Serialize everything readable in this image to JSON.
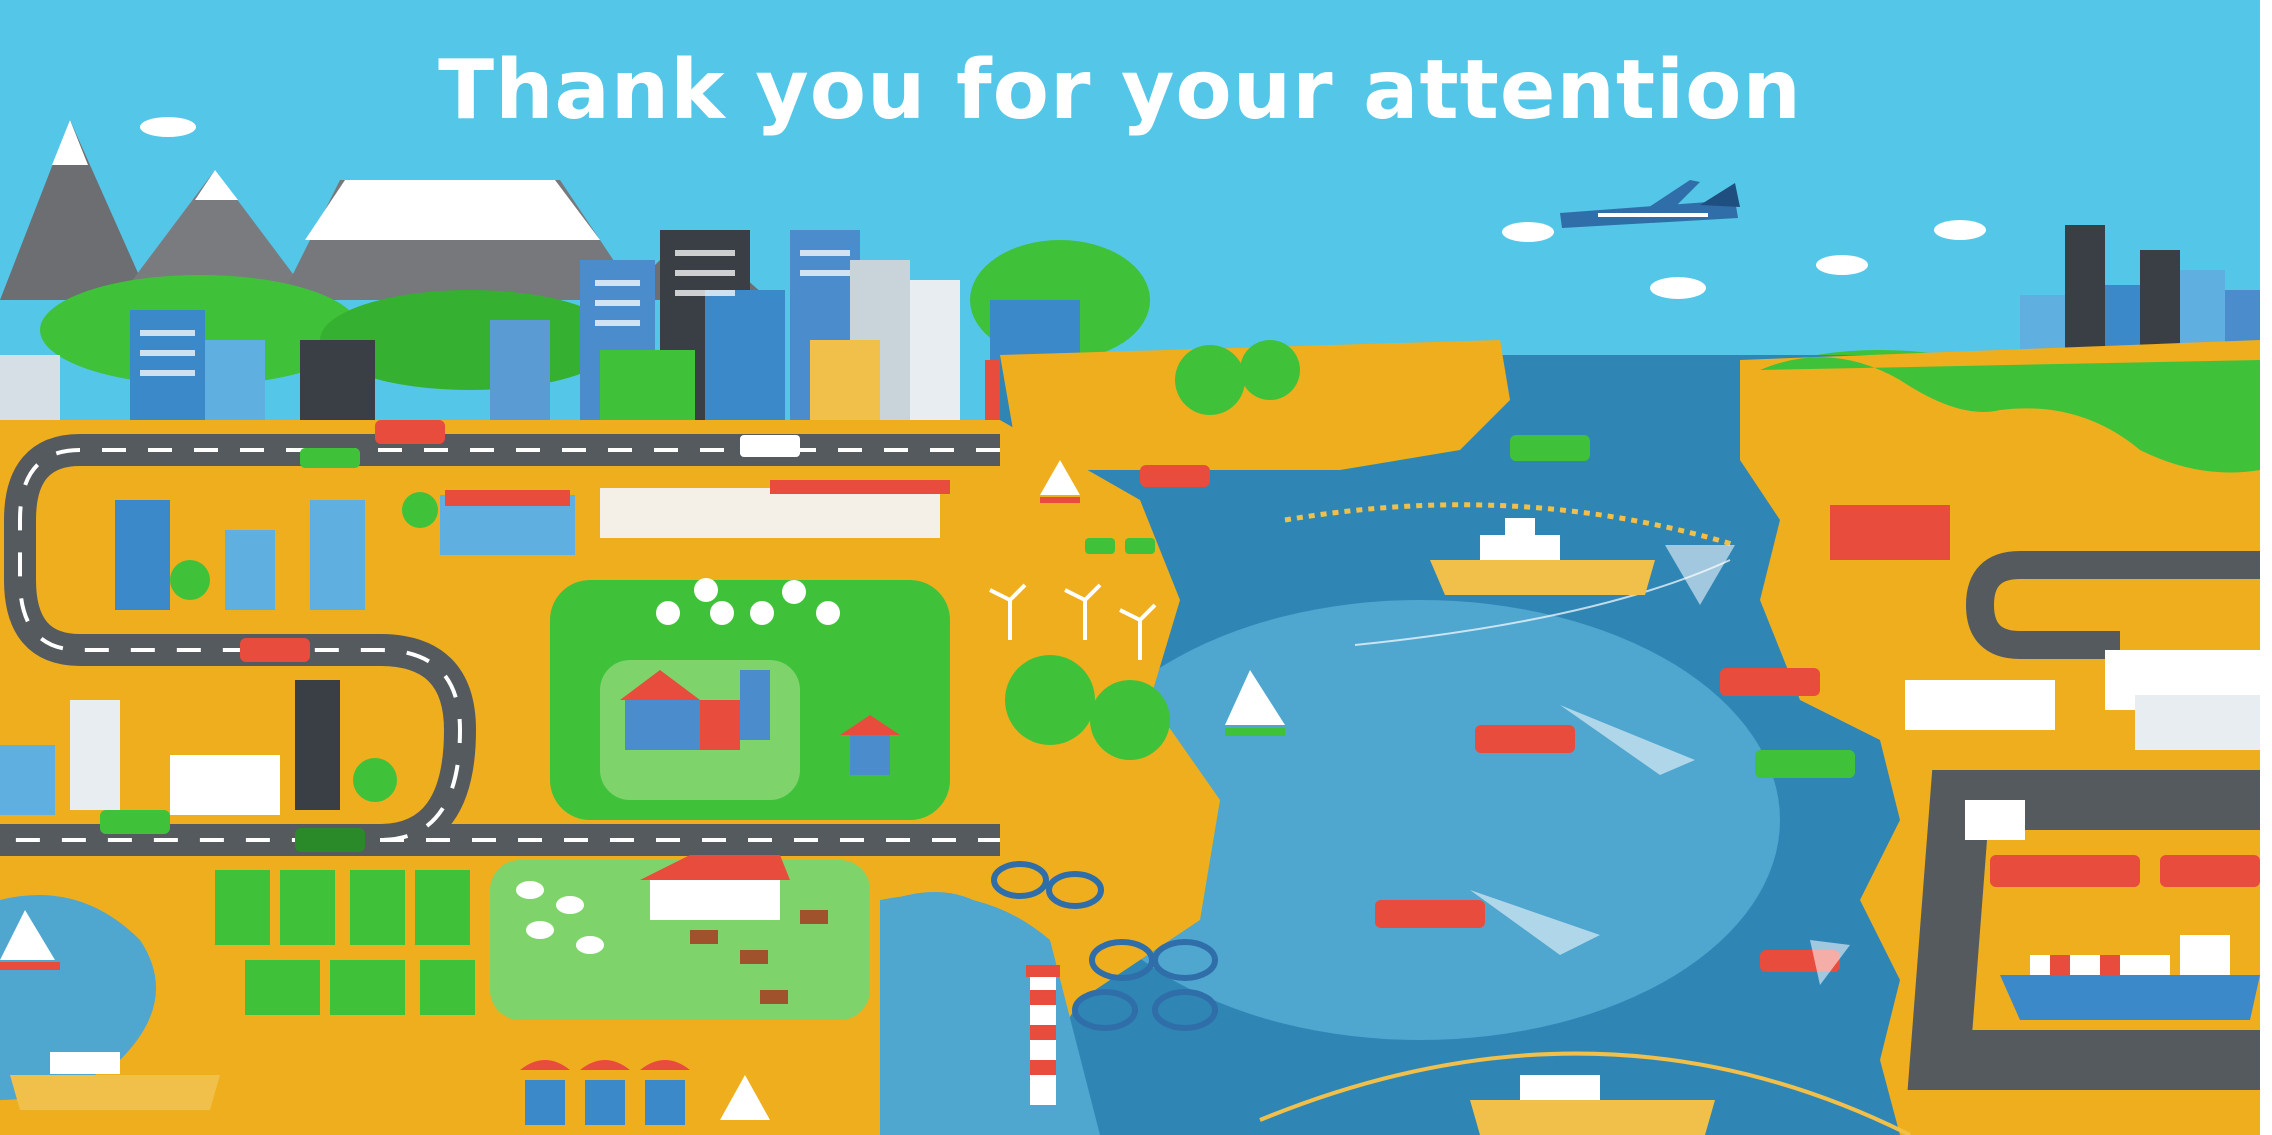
{
  "slide": {
    "title": "Thank you for your attention"
  },
  "colors": {
    "sky": "#54c6e8",
    "sea": "#2f86b5",
    "sea_light": "#4fa6cf",
    "land": "#efae1e",
    "grass": "#3fc23a",
    "road": "#555a5f",
    "mountain": "#6d6e71",
    "snow": "#ffffff",
    "boat_red": "#e84c3d",
    "boat_yellow": "#f0c04a"
  },
  "icons": [
    "mountain-icon",
    "building-icon",
    "farm-barn-icon",
    "wind-turbine-icon",
    "airplane-icon",
    "cloud-icon",
    "fishing-boat-icon",
    "sailboat-icon",
    "lighthouse-icon",
    "fish-cage-icon",
    "container-ship-icon",
    "car-icon",
    "tree-icon",
    "sheep-icon",
    "horse-icon",
    "market-stall-icon",
    "fishing-net-icon"
  ]
}
